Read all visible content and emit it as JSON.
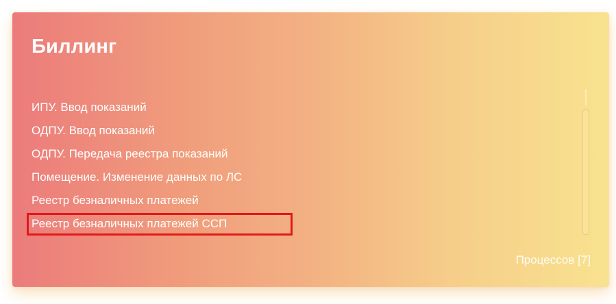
{
  "card": {
    "title": "Биллинг",
    "processes": [
      {
        "label": "ИПУ. Ввод показаний"
      },
      {
        "label": "ОДПУ. Ввод показаний"
      },
      {
        "label": "ОДПУ. Передача реестра показаний"
      },
      {
        "label": "Помещение. Изменение данных по ЛС"
      },
      {
        "label": "Реестр безналичных платежей"
      },
      {
        "label": "Реестр безналичных платежей ССП",
        "highlighted": true
      }
    ],
    "process_count_label": "Процессов [7]",
    "colors": {
      "gradient_start": "#ec7b7b",
      "gradient_end": "#f8e28f",
      "text": "#ffffff",
      "highlight_border": "#e01919"
    }
  }
}
